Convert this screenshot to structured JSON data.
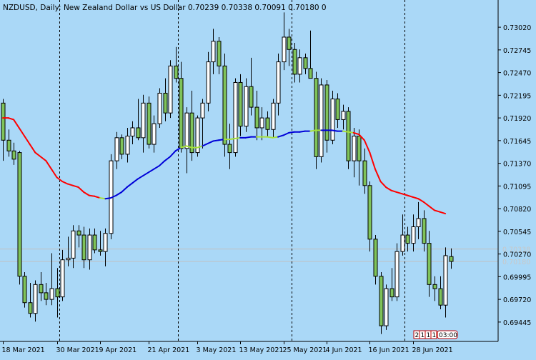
{
  "window": {
    "symbol_label": "NZDUSD, Daily:",
    "description": "New Zealand Dollar vs US Dollar",
    "ohlc_values": "0.70239 0.70338 0.70091 0.70180",
    "volume_value": "0",
    "corner_badges": [
      "2",
      "1",
      "1",
      "1"
    ],
    "countdown": "03:00"
  },
  "colors": {
    "background": "#aad8f7",
    "bull_body": "#ffffff",
    "bear_body": "#7fc35a",
    "wick": "#000000",
    "ma_up": "#0000d8",
    "ma_down": "#ff0000",
    "ma_flat": "#a6e03c",
    "separator": "#000000"
  },
  "chart_data": {
    "type": "candlestick",
    "title": "NZDUSD, Daily: New Zealand Dollar vs US Dollar",
    "y_ticks": [
      "0.73020",
      "0.72745",
      "0.72470",
      "0.72195",
      "0.71920",
      "0.71645",
      "0.71370",
      "0.71095",
      "0.70820",
      "0.70545",
      "0.70270",
      "0.69995",
      "0.69720",
      "0.69445"
    ],
    "ylim": [
      0.6921,
      0.7335
    ],
    "x_tick_labels": [
      "18 Mar 2021",
      "30 Mar 2021",
      "9 Apr 2021",
      "21 Apr 2021",
      "3 May 2021",
      "13 May 2021",
      "25 May 2021",
      "4 Jun 2021",
      "16 Jun 2021",
      "28 Jun 2021"
    ],
    "x_tick_candle_index": [
      0,
      10,
      18,
      27,
      36,
      44,
      52,
      60,
      68,
      76
    ],
    "month_separator_after_index": [
      10,
      32,
      53,
      74
    ],
    "price_lines": [
      0.7033,
      0.7018
    ],
    "price_line_labels": [
      "0.70338",
      "0.70180"
    ],
    "candles": [
      {
        "o": 0.721,
        "h": 0.7215,
        "l": 0.714,
        "c": 0.7165
      },
      {
        "o": 0.7165,
        "h": 0.7178,
        "l": 0.7145,
        "c": 0.7152
      },
      {
        "o": 0.7152,
        "h": 0.7162,
        "l": 0.7135,
        "c": 0.7142
      },
      {
        "o": 0.715,
        "h": 0.7152,
        "l": 0.699,
        "c": 0.7
      },
      {
        "o": 0.7,
        "h": 0.7005,
        "l": 0.6962,
        "c": 0.6968
      },
      {
        "o": 0.6968,
        "h": 0.6992,
        "l": 0.695,
        "c": 0.6955
      },
      {
        "o": 0.6955,
        "h": 0.6995,
        "l": 0.6945,
        "c": 0.699
      },
      {
        "o": 0.699,
        "h": 0.7005,
        "l": 0.697,
        "c": 0.698
      },
      {
        "o": 0.698,
        "h": 0.6992,
        "l": 0.6965,
        "c": 0.6972
      },
      {
        "o": 0.6972,
        "h": 0.7028,
        "l": 0.6965,
        "c": 0.6985
      },
      {
        "o": 0.6985,
        "h": 0.701,
        "l": 0.695,
        "c": 0.6975
      },
      {
        "o": 0.6975,
        "h": 0.7032,
        "l": 0.697,
        "c": 0.702
      },
      {
        "o": 0.702,
        "h": 0.7048,
        "l": 0.7012,
        "c": 0.7022
      },
      {
        "o": 0.7022,
        "h": 0.7062,
        "l": 0.701,
        "c": 0.7055
      },
      {
        "o": 0.7055,
        "h": 0.7062,
        "l": 0.7035,
        "c": 0.705
      },
      {
        "o": 0.705,
        "h": 0.706,
        "l": 0.701,
        "c": 0.702
      },
      {
        "o": 0.702,
        "h": 0.7058,
        "l": 0.7008,
        "c": 0.705
      },
      {
        "o": 0.705,
        "h": 0.7058,
        "l": 0.7028,
        "c": 0.7032
      },
      {
        "o": 0.7032,
        "h": 0.7055,
        "l": 0.7025,
        "c": 0.703
      },
      {
        "o": 0.703,
        "h": 0.7058,
        "l": 0.7012,
        "c": 0.7052
      },
      {
        "o": 0.7052,
        "h": 0.7148,
        "l": 0.7045,
        "c": 0.714
      },
      {
        "o": 0.714,
        "h": 0.7175,
        "l": 0.713,
        "c": 0.7168
      },
      {
        "o": 0.7168,
        "h": 0.7172,
        "l": 0.7142,
        "c": 0.7148
      },
      {
        "o": 0.7148,
        "h": 0.718,
        "l": 0.7138,
        "c": 0.717
      },
      {
        "o": 0.717,
        "h": 0.7188,
        "l": 0.716,
        "c": 0.718
      },
      {
        "o": 0.718,
        "h": 0.7215,
        "l": 0.7165,
        "c": 0.7168
      },
      {
        "o": 0.7168,
        "h": 0.722,
        "l": 0.715,
        "c": 0.721
      },
      {
        "o": 0.721,
        "h": 0.7218,
        "l": 0.7155,
        "c": 0.716
      },
      {
        "o": 0.716,
        "h": 0.7195,
        "l": 0.715,
        "c": 0.7185
      },
      {
        "o": 0.7185,
        "h": 0.7228,
        "l": 0.718,
        "c": 0.7222
      },
      {
        "o": 0.7222,
        "h": 0.724,
        "l": 0.7188,
        "c": 0.7198
      },
      {
        "o": 0.7198,
        "h": 0.7262,
        "l": 0.7192,
        "c": 0.7255
      },
      {
        "o": 0.7255,
        "h": 0.7278,
        "l": 0.7235,
        "c": 0.724
      },
      {
        "o": 0.724,
        "h": 0.726,
        "l": 0.715,
        "c": 0.7155
      },
      {
        "o": 0.7155,
        "h": 0.7205,
        "l": 0.7125,
        "c": 0.7198
      },
      {
        "o": 0.7198,
        "h": 0.7225,
        "l": 0.714,
        "c": 0.715
      },
      {
        "o": 0.715,
        "h": 0.7195,
        "l": 0.7145,
        "c": 0.7192
      },
      {
        "o": 0.7192,
        "h": 0.7215,
        "l": 0.7155,
        "c": 0.721
      },
      {
        "o": 0.721,
        "h": 0.7272,
        "l": 0.72,
        "c": 0.726
      },
      {
        "o": 0.726,
        "h": 0.73,
        "l": 0.7245,
        "c": 0.7285
      },
      {
        "o": 0.7285,
        "h": 0.729,
        "l": 0.7245,
        "c": 0.7255
      },
      {
        "o": 0.7255,
        "h": 0.727,
        "l": 0.7145,
        "c": 0.716
      },
      {
        "o": 0.716,
        "h": 0.7185,
        "l": 0.713,
        "c": 0.715
      },
      {
        "o": 0.715,
        "h": 0.724,
        "l": 0.7145,
        "c": 0.7235
      },
      {
        "o": 0.7235,
        "h": 0.7245,
        "l": 0.717,
        "c": 0.7182
      },
      {
        "o": 0.7182,
        "h": 0.724,
        "l": 0.7175,
        "c": 0.723
      },
      {
        "o": 0.723,
        "h": 0.7265,
        "l": 0.7195,
        "c": 0.7205
      },
      {
        "o": 0.7205,
        "h": 0.7225,
        "l": 0.7165,
        "c": 0.718
      },
      {
        "o": 0.718,
        "h": 0.7205,
        "l": 0.7165,
        "c": 0.7192
      },
      {
        "o": 0.7192,
        "h": 0.72,
        "l": 0.717,
        "c": 0.7178
      },
      {
        "o": 0.7178,
        "h": 0.7215,
        "l": 0.7168,
        "c": 0.721
      },
      {
        "o": 0.721,
        "h": 0.727,
        "l": 0.7195,
        "c": 0.726
      },
      {
        "o": 0.726,
        "h": 0.732,
        "l": 0.725,
        "c": 0.729
      },
      {
        "o": 0.729,
        "h": 0.73,
        "l": 0.7255,
        "c": 0.7275
      },
      {
        "o": 0.7275,
        "h": 0.7283,
        "l": 0.7235,
        "c": 0.7245
      },
      {
        "o": 0.7245,
        "h": 0.7275,
        "l": 0.7235,
        "c": 0.7265
      },
      {
        "o": 0.7265,
        "h": 0.727,
        "l": 0.7245,
        "c": 0.7252
      },
      {
        "o": 0.7252,
        "h": 0.7298,
        "l": 0.7245,
        "c": 0.724
      },
      {
        "o": 0.724,
        "h": 0.7248,
        "l": 0.713,
        "c": 0.7145
      },
      {
        "o": 0.7145,
        "h": 0.724,
        "l": 0.7138,
        "c": 0.7232
      },
      {
        "o": 0.7232,
        "h": 0.7238,
        "l": 0.715,
        "c": 0.7165
      },
      {
        "o": 0.7165,
        "h": 0.7225,
        "l": 0.716,
        "c": 0.7215
      },
      {
        "o": 0.7215,
        "h": 0.7222,
        "l": 0.718,
        "c": 0.719
      },
      {
        "o": 0.719,
        "h": 0.7208,
        "l": 0.7178,
        "c": 0.72
      },
      {
        "o": 0.72,
        "h": 0.7205,
        "l": 0.713,
        "c": 0.714
      },
      {
        "o": 0.714,
        "h": 0.718,
        "l": 0.712,
        "c": 0.717
      },
      {
        "o": 0.717,
        "h": 0.7178,
        "l": 0.711,
        "c": 0.714
      },
      {
        "o": 0.714,
        "h": 0.7155,
        "l": 0.71,
        "c": 0.711
      },
      {
        "o": 0.711,
        "h": 0.7115,
        "l": 0.703,
        "c": 0.7045
      },
      {
        "o": 0.7045,
        "h": 0.705,
        "l": 0.699,
        "c": 0.7
      },
      {
        "o": 0.7,
        "h": 0.7005,
        "l": 0.693,
        "c": 0.694
      },
      {
        "o": 0.694,
        "h": 0.699,
        "l": 0.6935,
        "c": 0.6985
      },
      {
        "o": 0.6985,
        "h": 0.701,
        "l": 0.697,
        "c": 0.6975
      },
      {
        "o": 0.6975,
        "h": 0.704,
        "l": 0.697,
        "c": 0.703
      },
      {
        "o": 0.703,
        "h": 0.7075,
        "l": 0.7025,
        "c": 0.705
      },
      {
        "o": 0.705,
        "h": 0.706,
        "l": 0.703,
        "c": 0.704
      },
      {
        "o": 0.704,
        "h": 0.7075,
        "l": 0.703,
        "c": 0.706
      },
      {
        "o": 0.706,
        "h": 0.709,
        "l": 0.7045,
        "c": 0.707
      },
      {
        "o": 0.707,
        "h": 0.708,
        "l": 0.703,
        "c": 0.704
      },
      {
        "o": 0.704,
        "h": 0.7055,
        "l": 0.6975,
        "c": 0.699
      },
      {
        "o": 0.699,
        "h": 0.7,
        "l": 0.697,
        "c": 0.6985
      },
      {
        "o": 0.6985,
        "h": 0.7,
        "l": 0.696,
        "c": 0.6965
      },
      {
        "o": 0.6965,
        "h": 0.7035,
        "l": 0.695,
        "c": 0.7025
      },
      {
        "o": 0.70239,
        "h": 0.70338,
        "l": 0.70091,
        "c": 0.7018
      }
    ],
    "ma_values": [
      0.7192,
      0.7192,
      0.719,
      0.718,
      0.717,
      0.716,
      0.715,
      0.7145,
      0.714,
      0.713,
      0.712,
      0.7115,
      0.7112,
      0.711,
      0.7108,
      0.7102,
      0.7098,
      0.7097,
      0.7095,
      0.7094,
      0.7095,
      0.7098,
      0.7102,
      0.7108,
      0.7113,
      0.7118,
      0.7122,
      0.7126,
      0.713,
      0.7134,
      0.714,
      0.7145,
      0.7152,
      0.7156,
      0.7158,
      0.7156,
      0.7156,
      0.7158,
      0.7161,
      0.7164,
      0.7165,
      0.7166,
      0.7166,
      0.7167,
      0.7168,
      0.7168,
      0.7169,
      0.7169,
      0.7169,
      0.7169,
      0.7168,
      0.7169,
      0.7171,
      0.7174,
      0.7175,
      0.7175,
      0.7176,
      0.7176,
      0.7177,
      0.7177,
      0.7177,
      0.7177,
      0.7176,
      0.7176,
      0.7175,
      0.7174,
      0.7172,
      0.7165,
      0.715,
      0.713,
      0.7115,
      0.7108,
      0.7104,
      0.7102,
      0.71,
      0.7098,
      0.7096,
      0.7094,
      0.709,
      0.7085,
      0.708,
      0.7078,
      0.7076
    ],
    "ma_state": [
      "down",
      "down",
      "down",
      "down",
      "down",
      "down",
      "down",
      "down",
      "down",
      "down",
      "down",
      "down",
      "down",
      "down",
      "down",
      "down",
      "down",
      "down",
      "down",
      "flat",
      "up",
      "up",
      "up",
      "up",
      "up",
      "up",
      "up",
      "up",
      "up",
      "up",
      "up",
      "up",
      "up",
      "up",
      "flat",
      "flat",
      "flat",
      "flat",
      "up",
      "up",
      "up",
      "up",
      "flat",
      "flat",
      "flat",
      "up",
      "up",
      "up",
      "flat",
      "flat",
      "flat",
      "flat",
      "up",
      "up",
      "up",
      "up",
      "up",
      "up",
      "flat",
      "flat",
      "up",
      "up",
      "up",
      "up",
      "flat",
      "flat",
      "down",
      "down",
      "down",
      "down",
      "down",
      "down",
      "down",
      "down",
      "down",
      "down",
      "down",
      "down",
      "down",
      "down",
      "down",
      "down",
      "down"
    ]
  }
}
